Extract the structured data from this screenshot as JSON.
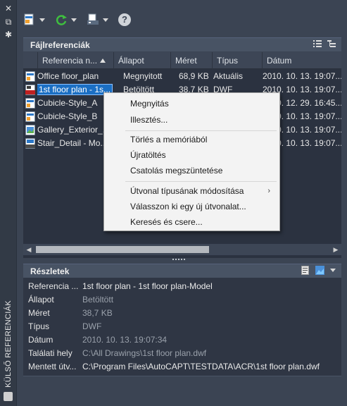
{
  "palette": {
    "title": "KÜLSŐ REFERENCIÁK"
  },
  "toolbar": {
    "buttons": [
      {
        "icon": "attach-dwg-icon",
        "has_dropdown": true
      },
      {
        "icon": "refresh-icon",
        "has_dropdown": true
      },
      {
        "icon": "change-path-icon",
        "has_dropdown": true
      },
      {
        "icon": "help-icon",
        "symbol": "?"
      }
    ]
  },
  "file_refs": {
    "title": "Fájlreferenciák",
    "columns": [
      "Referencia n...",
      "Állapot",
      "Méret",
      "Típus",
      "Dátum"
    ],
    "sort_column": "Referencia n...",
    "rows": [
      {
        "name": "Office floor_plan",
        "status": "Megnyitott",
        "size": "68,9 KB",
        "type": "Aktuális",
        "date": "2010. 10. 13. 19:07...",
        "icon": "dwg-file-icon"
      },
      {
        "name": "1st floor plan - 1s...",
        "status": "Betöltött",
        "size": "38,7 KB",
        "type": "DWF",
        "date": "2010. 10. 13. 19:07...",
        "icon": "dwf-file-icon",
        "selected": true
      },
      {
        "name": "Cubicle-Style_A",
        "status": "",
        "size": "",
        "type": "",
        "date": "2010. 12. 29. 16:45...",
        "icon": "dwg-file-icon"
      },
      {
        "name": "Cubicle-Style_B",
        "status": "",
        "size": "",
        "type": "",
        "date": "2010. 10. 13. 19:07...",
        "icon": "dwg-file-icon"
      },
      {
        "name": "Gallery_Exterior_...",
        "status": "",
        "size": "",
        "type": "",
        "date": "2010. 10. 13. 19:07...",
        "icon": "image-file-icon"
      },
      {
        "name": "Stair_Detail - Mo...",
        "status": "",
        "size": "",
        "type": "",
        "date": "2010. 10. 13. 19:07...",
        "icon": "dgn-file-icon"
      }
    ]
  },
  "context_menu": {
    "items": [
      {
        "label": "Megnyitás",
        "name": "menu-open"
      },
      {
        "label": "Illesztés...",
        "name": "menu-attach"
      },
      {
        "separator": true
      },
      {
        "label": "Törlés a memóriából",
        "name": "menu-unload"
      },
      {
        "label": "Újratöltés",
        "name": "menu-reload"
      },
      {
        "label": "Csatolás megszüntetése",
        "name": "menu-detach"
      },
      {
        "separator": true
      },
      {
        "label": "Útvonal típusának módosítása",
        "name": "menu-path-type",
        "submenu": true
      },
      {
        "label": "Válasszon ki egy új útvonalat...",
        "name": "menu-new-path"
      },
      {
        "label": "Keresés és csere...",
        "name": "menu-find-replace"
      }
    ],
    "submenu_arrow": "›"
  },
  "details": {
    "title": "Részletek",
    "rows": [
      {
        "label": "Referencia ...",
        "value": "1st floor plan - 1st floor plan-Model",
        "bright": true
      },
      {
        "label": "Állapot",
        "value": "Betöltött"
      },
      {
        "label": "Méret",
        "value": "38,7 KB"
      },
      {
        "label": "Típus",
        "value": "DWF"
      },
      {
        "label": "Dátum",
        "value": "2010. 10. 13. 19:07:34"
      },
      {
        "label": "Találati hely",
        "value": "C:\\All Drawings\\1st floor plan.dwf"
      },
      {
        "label": "Mentett útv...",
        "value": "C:\\Program Files\\AutoCAPT\\TESTDATA\\ACR\\1st floor plan.dwf",
        "bright": true
      }
    ]
  },
  "colors": {
    "background": "#3b4453",
    "selection": "#1b6fc4",
    "menu_bg": "#f3f3f3"
  }
}
